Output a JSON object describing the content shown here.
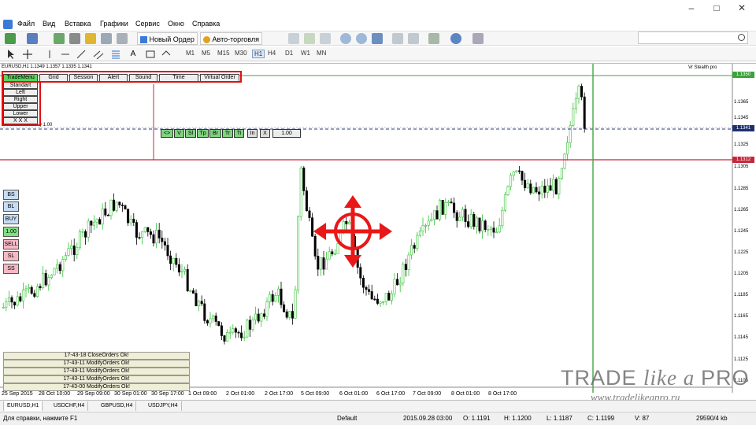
{
  "menubar": {
    "items": [
      "Файл",
      "Вид",
      "Вставка",
      "Графики",
      "Сервис",
      "Окно",
      "Справка"
    ]
  },
  "toolbar": {
    "new_order_label": "Новый Ордер",
    "autotrade_label": "Авто-торговля",
    "timeframes": [
      "M1",
      "M5",
      "M15",
      "M30",
      "H1",
      "H4",
      "D1",
      "W1",
      "MN"
    ]
  },
  "chart": {
    "title": "EURUSD,H1 1.1349 1.1357 1.1335 1.1341",
    "indicator_name": "Vr Stealth pro",
    "price_tags": {
      "top": "1.1350",
      "mid": "1.1341",
      "low": "1.1312"
    },
    "y_ticks": [
      "1.1365",
      "1.1345",
      "1.1325",
      "1.1305",
      "1.1285",
      "1.1265",
      "1.1245",
      "1.1225",
      "1.1205",
      "1.1185",
      "1.1165",
      "1.1145",
      "1.1125",
      "1.1105"
    ],
    "x_ticks": [
      "25 Sep 2015",
      "28 Oct 10:00",
      "29 Sep 09:00",
      "30 Sep 01:00",
      "30 Sep 17:00",
      "1 Oct 09:00",
      "2 Oct 01:00",
      "2 Oct 17:00",
      "5 Oct 09:00",
      "6 Oct 01:00",
      "6 Oct 17:00",
      "7 Oct 09:00",
      "8 Oct 01:00",
      "8 Oct 17:00"
    ],
    "lot_line_text": "y 1.00",
    "colors": {
      "bull": "#35c235",
      "bear": "#000000",
      "up_arrow": "#e81818",
      "sl_line": "#c4283b",
      "green_line": "#43a543",
      "dash_line": "#2b3a78"
    }
  },
  "trade_panel": {
    "tabs": [
      "TradeMenu",
      "Grid",
      "Session",
      "Alert",
      "Sound",
      "Time",
      "Virtual Order"
    ],
    "menu_items": [
      "Standart",
      "Left",
      "Right",
      "Upper",
      "Lower",
      "X X X"
    ],
    "order_buttons": [
      "<>",
      "V",
      "Sl",
      "Tp",
      "Br",
      "Tr",
      "Ti",
      "In",
      "X"
    ],
    "lot_value": "1.00",
    "side_buttons": [
      "BS",
      "BL",
      "BUY",
      "1.00",
      "SELL",
      "SL",
      "SS"
    ]
  },
  "log": {
    "lines": [
      "17-43-18 CloseOrders Ok!",
      "17-43-11 ModifyOrders Ok!",
      "17-43-11 ModifyOrders Ok!",
      "17-43-11 ModifyOrders Ok!",
      "17-43-00 ModifyOrders Ok!"
    ]
  },
  "watermark": {
    "line1_a": "TRADE ",
    "line1_b": "like",
    "line1_c": " a ",
    "line1_d": "PRO",
    "line2": "www.tradelikeapro.ru"
  },
  "symbol_tabs": [
    "EURUSD,H1",
    "USDCHF,H4",
    "GBPUSD,H4",
    "USDJPY,H4"
  ],
  "status": {
    "help": "Для справки, нажмите F1",
    "profile": "Default",
    "datetime": "2015.09.28 03:00",
    "open": "O: 1.1191",
    "high": "H: 1.1200",
    "low": "L: 1.1187",
    "close": "C: 1.1199",
    "volume": "V: 87",
    "traffic": "29590/4 kb"
  }
}
